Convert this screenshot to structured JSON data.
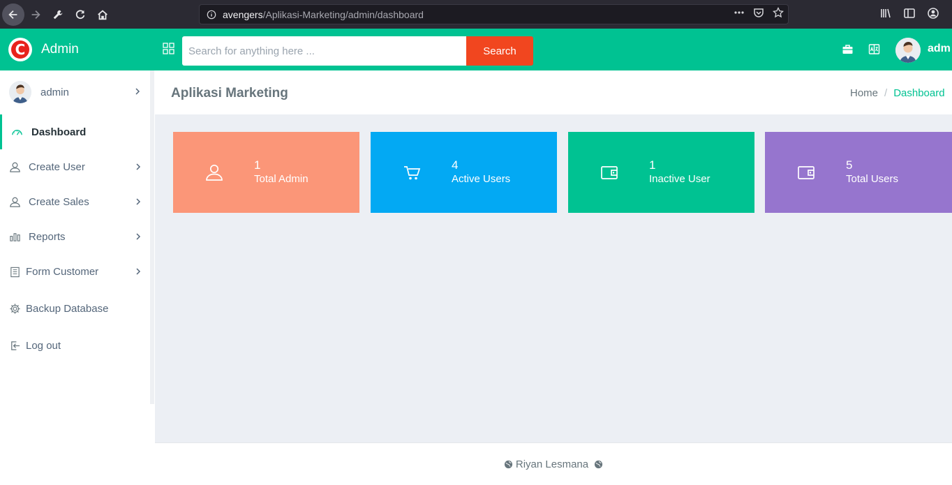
{
  "browser": {
    "url_host": "avengers",
    "url_path": "/Aplikasi-Marketing/admin/dashboard"
  },
  "header": {
    "brand_letter": "C",
    "brand_name": "Admin",
    "search_placeholder": "Search for anything here ...",
    "search_button": "Search",
    "user_name": "adm"
  },
  "sidebar": {
    "user_name": "admin",
    "items": [
      {
        "label": "Dashboard"
      },
      {
        "label": "Create User"
      },
      {
        "label": "Create Sales"
      },
      {
        "label": "Reports"
      },
      {
        "label": "Form Customer"
      },
      {
        "label": "Backup Database"
      },
      {
        "label": "Log out"
      }
    ]
  },
  "page": {
    "title": "Aplikasi Marketing",
    "breadcrumb_home": "Home",
    "breadcrumb_sep": "/",
    "breadcrumb_current": "Dashboard"
  },
  "cards": [
    {
      "value": "1",
      "label": "Total Admin",
      "color": "#fb9678",
      "icon": "user-icon"
    },
    {
      "value": "4",
      "label": "Active Users",
      "color": "#03a9f3",
      "icon": "cart-icon"
    },
    {
      "value": "1",
      "label": "Inactive User",
      "color": "#00c292",
      "icon": "wallet-icon"
    },
    {
      "value": "5",
      "label": "Total Users",
      "color": "#9675ce",
      "icon": "wallet-icon"
    }
  ],
  "footer": {
    "text": "Riyan Lesmana"
  },
  "colors": {
    "accent": "#00c292",
    "search_button": "#f1461f"
  }
}
